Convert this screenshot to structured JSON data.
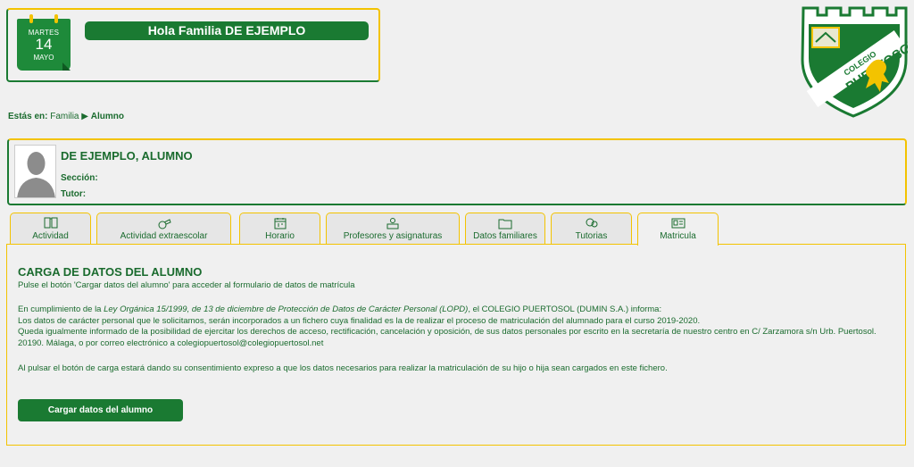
{
  "header": {
    "calendar": {
      "weekday": "MARTES",
      "day": "14",
      "month": "MAYO"
    },
    "greeting": "Hola Familia DE EJEMPLO"
  },
  "logo": {
    "text": "COLEGIO PUERTOSOL",
    "icon": "school-shield-logo"
  },
  "breadcrumb": {
    "prefix": "Estás en:",
    "parent": "Familia",
    "separator": "▶",
    "current": "Alumno"
  },
  "student": {
    "name": "DE EJEMPLO, ALUMNO",
    "section_label": "Sección:",
    "tutor_label": "Tutor:"
  },
  "tabs": [
    {
      "label": "Actividad",
      "icon": "book-icon"
    },
    {
      "label": "Actividad extraescolar",
      "icon": "whistle-icon"
    },
    {
      "label": "Horario",
      "icon": "calendar-icon"
    },
    {
      "label": "Profesores y asignaturas",
      "icon": "teacher-icon"
    },
    {
      "label": "Datos familiares",
      "icon": "folder-icon"
    },
    {
      "label": "Tutorias",
      "icon": "chat-icon"
    },
    {
      "label": "Matricula",
      "icon": "id-card-icon"
    }
  ],
  "active_tab": "Matricula",
  "matricula": {
    "title": "CARGA DE DATOS DEL ALUMNO",
    "subtitle": "Pulse el botón 'Cargar datos del alumno' para acceder al formulario de datos de matrícula",
    "legal_intro_pre": "En cumplimiento de la ",
    "legal_law": "Ley Orgánica 15/1999, de 13 de diciembre de Protección de Datos de Carácter Personal (LOPD)",
    "legal_intro_post": ", el COLEGIO PUERTOSOL (DUMIN S.A.) informa:",
    "legal_line2": "Los datos de carácter personal que le solicitamos, serán incorporados a un fichero cuya finalidad es la de realizar el proceso de matriculación del alumnado para el curso 2019-2020.",
    "legal_line3": "Queda igualmente informado de la posibilidad de ejercitar los derechos de acceso, rectificación, cancelación y oposición, de sus datos personales por escrito en la secretaría de nuestro centro en C/ Zarzamora s/n Urb. Puertosol. 20190. Málaga, o por correo electrónico a colegiopuertosol@colegiopuertosol.net",
    "consent": "Al pulsar el botón de carga estará dando su consentimiento expreso a que los datos necesarios para realizar la matriculación de su hijo o hija sean cargados en este fichero.",
    "button_label": "Cargar datos del alumno"
  },
  "colors": {
    "primary_green": "#1a7a32",
    "accent_yellow": "#f3c300",
    "background": "#f0f0f0"
  }
}
